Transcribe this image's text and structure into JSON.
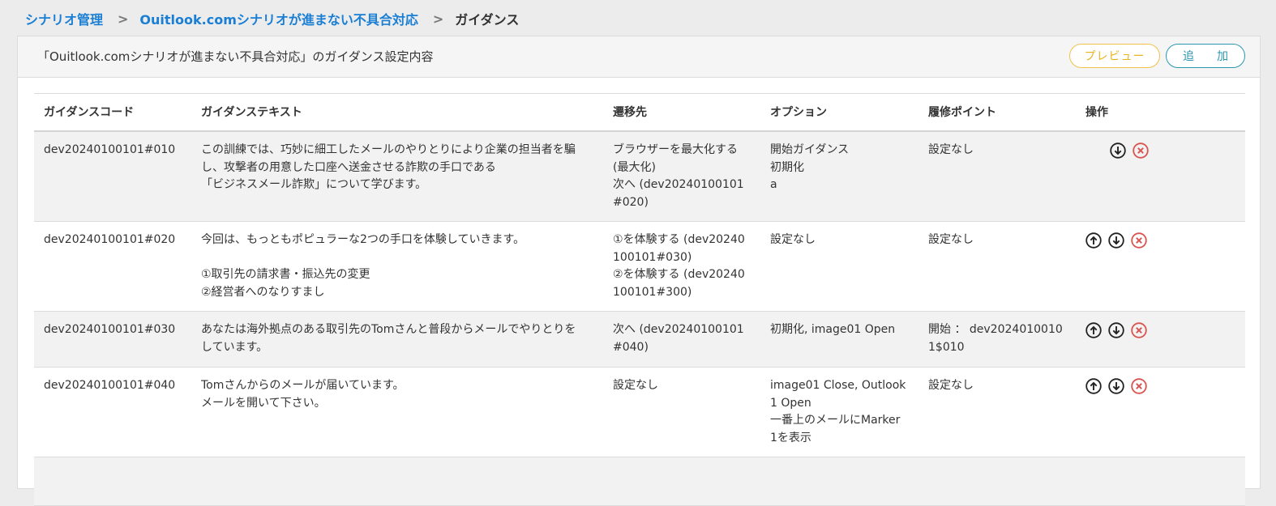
{
  "breadcrumb": {
    "item1": "シナリオ管理",
    "item2": "Ouitlook.comシナリオが進まない不具合対応",
    "current": "ガイダンス",
    "separator": ">"
  },
  "panel": {
    "title": "「Ouitlook.comシナリオが進まない不具合対応」のガイダンス設定内容",
    "preview_label": "プレビュー",
    "add_label_a": "追",
    "add_label_b": "加"
  },
  "table": {
    "headers": {
      "code": "ガイダンスコード",
      "text": "ガイダンステキスト",
      "dest": "遷移先",
      "option": "オプション",
      "point": "履修ポイント",
      "ops": "操作"
    },
    "rows": [
      {
        "code": "dev20240100101#010",
        "text": "この訓練では、巧妙に細工したメールのやりとりにより企業の担当者を騙\nし、攻撃者の用意した口座へ送金させる詐欺の手口である\n「ビジネスメール詐欺」について学びます。",
        "dest": "ブラウザーを最大化する\n(最大化)\n次へ (dev20240100101\n#020)",
        "option": "開始ガイダンス\n初期化\na",
        "point": "設定なし"
      },
      {
        "code": "dev20240100101#020",
        "text": "今回は、もっともポピュラーな2つの手口を体験していきます。\n\n①取引先の請求書・振込先の変更\n②経営者へのなりすまし",
        "dest": "①を体験する (dev20240\n100101#030)\n②を体験する (dev20240\n100101#300)",
        "option": "設定なし",
        "point": "設定なし"
      },
      {
        "code": "dev20240100101#030",
        "text": "あなたは海外拠点のある取引先のTomさんと普段からメールでやりとりを\nしています。",
        "dest": "次へ (dev20240100101\n#040)",
        "option": "初期化, image01 Open",
        "point": "開始 ： dev2024010010\n1$010"
      },
      {
        "code": "dev20240100101#040",
        "text": "Tomさんからのメールが届いています。\nメールを開いて下さい。",
        "dest": "設定なし",
        "option": "image01 Close, Outlook\n1 Open\n一番上のメールにMarker\n1を表示",
        "point": "設定なし"
      }
    ]
  },
  "icons": {
    "up": "arrow-up-circle-icon",
    "down": "arrow-down-circle-icon",
    "delete": "delete-x-circle-icon"
  },
  "colors": {
    "link": "#1a7fd4",
    "preview": "#e8b420",
    "add": "#2b96b0",
    "delete": "#d9534f"
  }
}
